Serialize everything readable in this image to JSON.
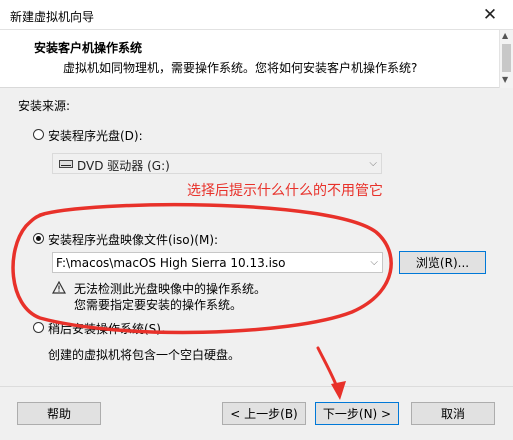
{
  "window": {
    "title": "新建虚拟机向导",
    "close_glyph": "✕"
  },
  "header": {
    "title": "安装客户机操作系统",
    "subtitle": "虚拟机如同物理机，需要操作系统。您将如何安装客户机操作系统?"
  },
  "install_source": {
    "label": "安装来源:",
    "options": [
      {
        "label": "安装程序光盘(D):",
        "selected": false
      },
      {
        "label": "安装程序光盘映像文件(iso)(M):",
        "selected": true
      },
      {
        "label": "稍后安装操作系统(S)。",
        "selected": false
      }
    ],
    "disc_drive": {
      "value": "DVD 驱动器 (G:)"
    },
    "iso_path": {
      "value": "F:\\macos\\macOS High Sierra 10.13.iso"
    },
    "browse_button": "浏览(R)...",
    "warning_line1": "无法检测此光盘映像中的操作系统。",
    "warning_line2": "您需要指定要安装的操作系统。",
    "later_desc": "创建的虚拟机将包含一个空白硬盘。"
  },
  "annotation": {
    "text": "选择后提示什么什么的不用管它",
    "color": "#e8312a"
  },
  "footer": {
    "help": "帮助",
    "back": "< 上一步(B)",
    "next": "下一步(N) >",
    "cancel": "取消"
  },
  "icons": [
    "close-icon",
    "dvd-drive-icon",
    "warning-icon",
    "dropdown-caret-icon"
  ]
}
